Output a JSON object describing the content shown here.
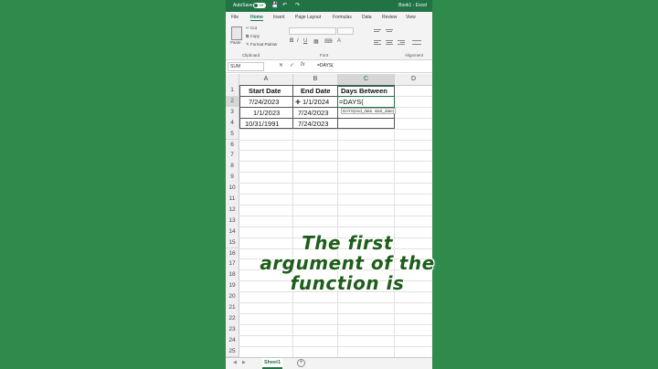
{
  "title_bar": {
    "autosave_label": "AutoSave",
    "toggle_state": "Off",
    "doc_name": "Book1 - Excel"
  },
  "menu": {
    "items": [
      "File",
      "Home",
      "Insert",
      "Page Layout",
      "Formulas",
      "Data",
      "Review",
      "View"
    ],
    "active": "Home"
  },
  "ribbon": {
    "paste_label": "Paste",
    "cut_label": "Cut",
    "copy_label": "Copy",
    "format_painter_label": "Format Painter",
    "groups": {
      "clipboard": "Clipboard",
      "font": "Font",
      "alignment": "Alignment"
    }
  },
  "formula_bar": {
    "name_box": "SUM",
    "formula": "=DAYS("
  },
  "columns": [
    "A",
    "B",
    "C",
    "D"
  ],
  "rows": [
    "1",
    "2",
    "3",
    "4",
    "5",
    "6",
    "7",
    "8",
    "9",
    "10",
    "11",
    "12",
    "13",
    "14",
    "15",
    "16",
    "17",
    "18",
    "19",
    "20",
    "21",
    "22",
    "23",
    "24",
    "25"
  ],
  "table": {
    "headers": [
      "Start Date",
      "End Date",
      "Days Between"
    ],
    "data": [
      [
        "7/24/2023",
        "1/1/2024",
        "=DAYS("
      ],
      [
        "1/1/2023",
        "7/24/2023",
        ""
      ],
      [
        "10/31/1991",
        "7/24/2023",
        ""
      ]
    ]
  },
  "tooltip": "DAYS(end_date, start_date)",
  "sheet_tab": "Sheet1",
  "caption": {
    "line1": "The first",
    "line2": "argument of the",
    "line3": "function is"
  },
  "colors": {
    "excel_green": "#217346",
    "background": "#2e8b4c",
    "caption_green": "#1e5d1a"
  }
}
